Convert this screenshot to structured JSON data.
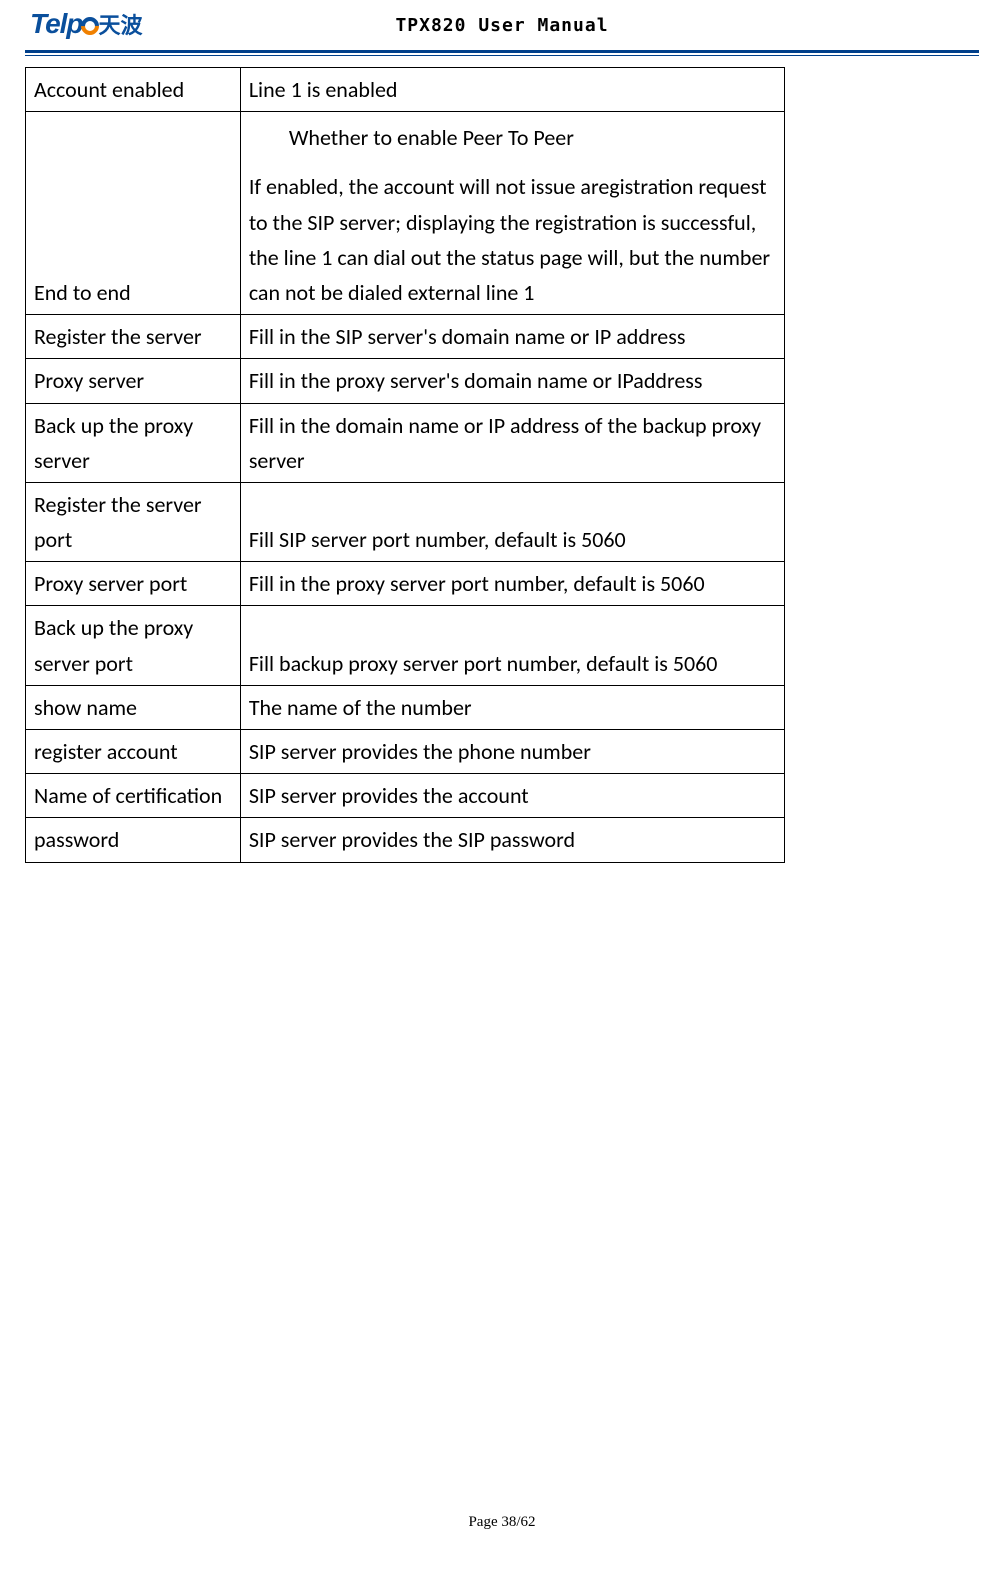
{
  "header": {
    "logo_text_part1": "Telp",
    "logo_text_chinese": "天波",
    "doc_title": "TPX820 User Manual"
  },
  "table": {
    "rows": [
      {
        "label": "Account enabled",
        "desc": "Line 1 is enabled"
      },
      {
        "label": "End to end",
        "desc_heading": "Whether to enable Peer To Peer",
        "desc_body": "If enabled, the account will not issue aregistration request to the SIP server; displaying the registration is successful, the line 1 can dial out the status page will, but the number can not be dialed external line 1"
      },
      {
        "label": "Register the server",
        "desc": "Fill in the SIP server's domain name or IP address"
      },
      {
        "label": "Proxy server",
        "desc": "Fill in the proxy server's domain name or IPaddress"
      },
      {
        "label": "Back up the proxy server",
        "desc": "Fill in the domain name or IP address of the backup proxy server"
      },
      {
        "label": "Register the server port",
        "desc": "Fill SIP server port number, default is 5060"
      },
      {
        "label": "Proxy server port",
        "desc": "Fill in the proxy server port number, default is 5060"
      },
      {
        "label": "Back up the proxy server port",
        "desc": "Fill backup proxy server port number, default is 5060"
      },
      {
        "label": "show name",
        "desc": "The name of the number"
      },
      {
        "label": "register account",
        "desc": "SIP server provides the phone number"
      },
      {
        "label": "Name of certification",
        "desc": "SIP server provides the account"
      },
      {
        "label": "password",
        "desc": "SIP server provides the SIP password"
      }
    ]
  },
  "footer": {
    "page_label": "Page 38/62"
  }
}
